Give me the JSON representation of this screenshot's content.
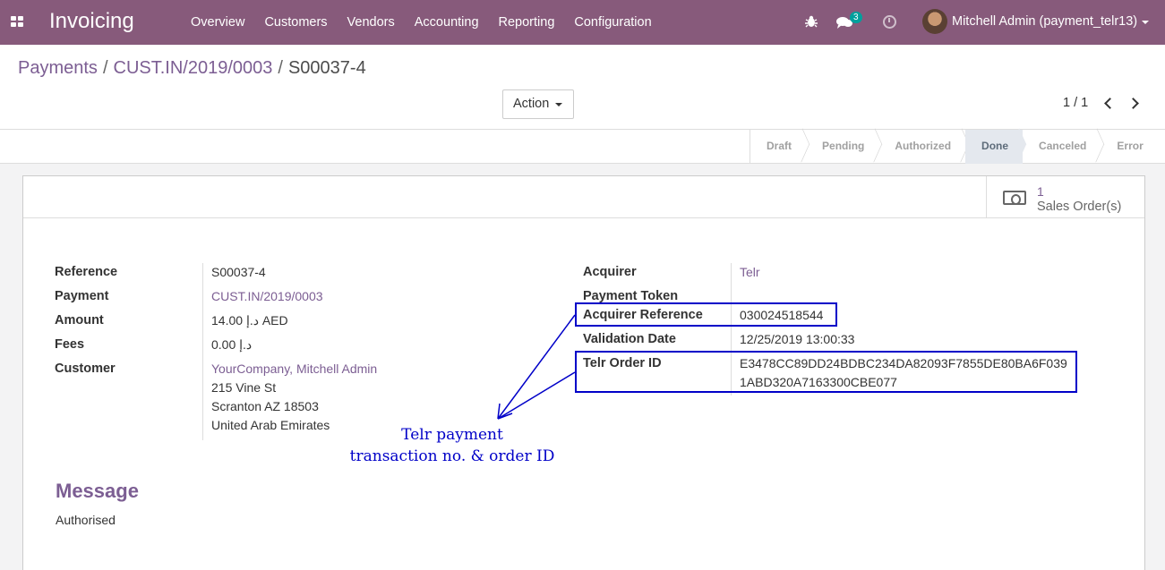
{
  "navbar": {
    "app_title": "Invoicing",
    "menu": [
      "Overview",
      "Customers",
      "Vendors",
      "Accounting",
      "Reporting",
      "Configuration"
    ],
    "messages_count": "3",
    "user": "Mitchell Admin (payment_telr13)",
    "bg_color": "#875a7b"
  },
  "breadcrumb": {
    "items": [
      "Payments",
      "CUST.IN/2019/0003"
    ],
    "separator": "/",
    "current": "S00037-4"
  },
  "toolbar": {
    "action_label": "Action",
    "pager": "1 / 1"
  },
  "statusbar": {
    "steps": [
      "Draft",
      "Pending",
      "Authorized",
      "Done",
      "Canceled",
      "Error"
    ],
    "active": "Done"
  },
  "smart_button": {
    "value": "1",
    "label": "Sales Order(s)",
    "icon": "money-icon"
  },
  "left_fields": {
    "reference": {
      "label": "Reference",
      "value": "S00037-4"
    },
    "payment": {
      "label": "Payment",
      "value": "CUST.IN/2019/0003"
    },
    "amount": {
      "label": "Amount",
      "value": "14.00 د.إ AED"
    },
    "fees": {
      "label": "Fees",
      "value": "0.00 د.إ"
    },
    "customer": {
      "label": "Customer",
      "name": "YourCompany, Mitchell Admin",
      "street": "215 Vine St",
      "city": "Scranton AZ 18503",
      "country": "United Arab Emirates"
    }
  },
  "right_fields": {
    "acquirer": {
      "label": "Acquirer",
      "value": "Telr"
    },
    "payment_token": {
      "label": "Payment Token",
      "value": ""
    },
    "acquirer_reference": {
      "label": "Acquirer Reference",
      "value": "030024518544"
    },
    "validation_date": {
      "label": "Validation Date",
      "value": "12/25/2019 13:00:33"
    },
    "telr_order_id": {
      "label": "Telr Order ID",
      "value_line1": "E3478CC89DD24BDBC234DA82093F7855DE80BA6F039",
      "value_line2": "1ABD320A7163300CBE077"
    }
  },
  "annotation": {
    "line1": "Telr payment",
    "line2": "transaction no. & order ID",
    "color": "#0000c8"
  },
  "message": {
    "title": "Message",
    "body": "Authorised"
  }
}
